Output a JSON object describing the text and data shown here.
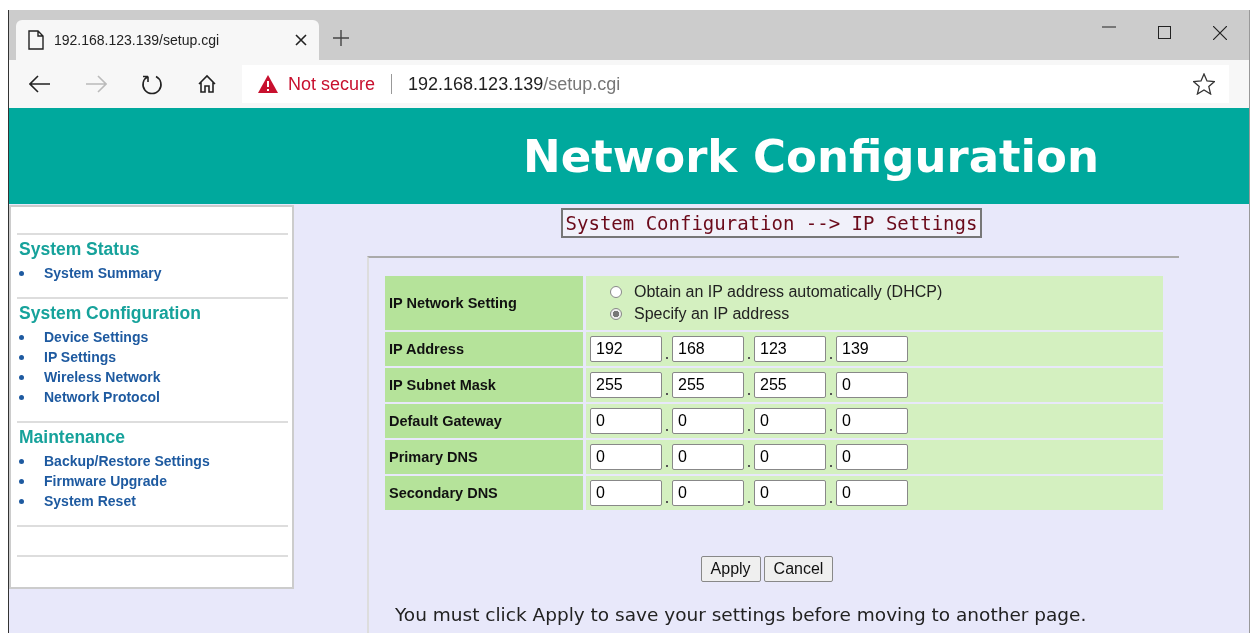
{
  "browser": {
    "tab_title": "192.168.123.139/setup.cgi",
    "security": "Not secure",
    "url_host": "192.168.123.139",
    "url_path": "/setup.cgi"
  },
  "header": {
    "title": "Network Configuration"
  },
  "sidebar": {
    "sections": [
      {
        "title": "System Status",
        "items": [
          "System Summary"
        ]
      },
      {
        "title": "System Configuration",
        "items": [
          "Device Settings",
          "IP Settings",
          "Wireless Network",
          "Network Protocol"
        ]
      },
      {
        "title": "Maintenance",
        "items": [
          "Backup/Restore Settings",
          "Firmware Upgrade",
          "System Reset"
        ]
      }
    ]
  },
  "page_title": "System Configuration --> IP Settings",
  "form": {
    "rows": [
      {
        "label": "IP Network Setting",
        "kind": "radio",
        "options": [
          {
            "label": "Obtain an IP address automatically (DHCP)",
            "selected": false
          },
          {
            "label": "Specify an IP address",
            "selected": true
          }
        ]
      },
      {
        "label": "IP Address",
        "kind": "ip",
        "octets": [
          "192",
          "168",
          "123",
          "139"
        ]
      },
      {
        "label": "IP Subnet Mask",
        "kind": "ip",
        "octets": [
          "255",
          "255",
          "255",
          "0"
        ]
      },
      {
        "label": "Default Gateway",
        "kind": "ip",
        "octets": [
          "0",
          "0",
          "0",
          "0"
        ]
      },
      {
        "label": "Primary DNS",
        "kind": "ip",
        "octets": [
          "0",
          "0",
          "0",
          "0"
        ]
      },
      {
        "label": "Secondary DNS",
        "kind": "ip",
        "octets": [
          "0",
          "0",
          "0",
          "0"
        ]
      }
    ]
  },
  "buttons": [
    "Apply",
    "Cancel"
  ],
  "note": "You must click Apply to save your settings before moving to another page."
}
